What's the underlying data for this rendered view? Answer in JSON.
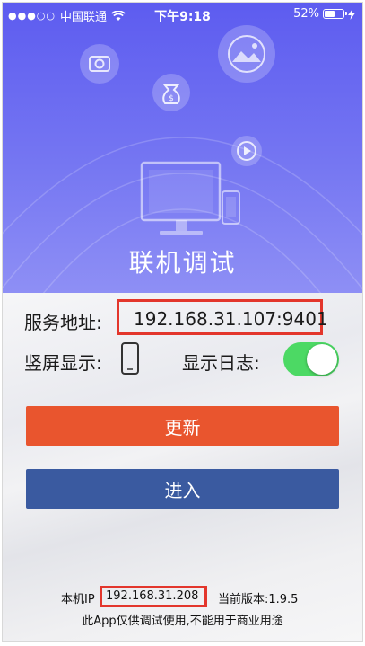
{
  "status_bar": {
    "signal": "●●●○○",
    "carrier": "中国联通",
    "time": "下午9:18",
    "battery": "52%"
  },
  "header": {
    "title": "联机调试"
  },
  "settings": {
    "server_label": "服务地址:",
    "server_value": "192.168.31.107:9401",
    "portrait_label": "竖屏显示:",
    "log_label": "显示日志:",
    "log_enabled": true
  },
  "buttons": {
    "update": "更新",
    "enter": "进入"
  },
  "footer": {
    "ip_label": "本机IP",
    "ip_value": "192.168.31.208",
    "version": "当前版本:1.9.5",
    "note": "此App仅供调试使用,不能用于商业用途"
  },
  "colors": {
    "header_top": "#5d5cf0",
    "update_button": "#e9552e",
    "enter_button": "#3a5aa0",
    "toggle_on": "#4cd964",
    "highlight_box": "#e3362c"
  }
}
